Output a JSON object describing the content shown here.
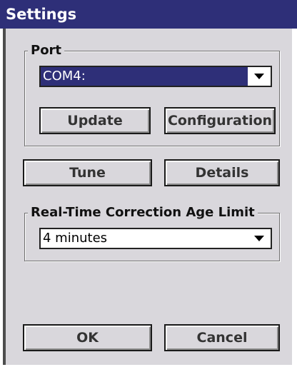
{
  "window": {
    "title": "Settings"
  },
  "port": {
    "group_label": "Port",
    "selected_value": "COM4:",
    "update_label": "Update",
    "configuration_label": "Configuration"
  },
  "actions": {
    "tune_label": "Tune",
    "details_label": "Details"
  },
  "age_limit": {
    "group_label": "Real-Time Correction Age Limit",
    "selected_value": "4 minutes"
  },
  "footer": {
    "ok_label": "OK",
    "cancel_label": "Cancel"
  },
  "colors": {
    "titlebar": "#2e2f78",
    "selection": "#2e2f78",
    "dialog_background": "#d9d7dc"
  }
}
